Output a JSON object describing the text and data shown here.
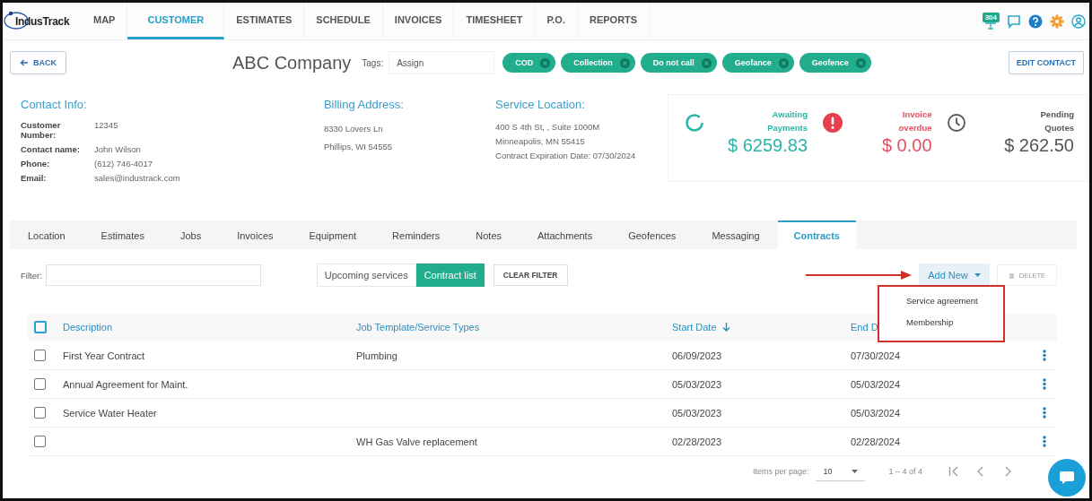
{
  "nav": {
    "logo": "IndusTrack",
    "items": [
      {
        "label": "MAP",
        "selected": false
      },
      {
        "label": "CUSTOMER",
        "selected": true
      },
      {
        "label": "ESTIMATES",
        "selected": false
      },
      {
        "label": "SCHEDULE",
        "selected": false
      },
      {
        "label": "INVOICES",
        "selected": false
      },
      {
        "label": "TIMESHEET",
        "selected": false
      },
      {
        "label": "P.O.",
        "selected": false
      },
      {
        "label": "REPORTS",
        "selected": false
      }
    ],
    "badge": "304"
  },
  "header": {
    "back": "BACK",
    "title": "ABC Company",
    "tags_label": "Tags:",
    "tag_input": {
      "placeholder": "Assign"
    },
    "tags": [
      "COD",
      "Collection",
      "Do not call",
      "Geofance",
      "Geofence"
    ],
    "edit": "EDIT CONTACT"
  },
  "contact": {
    "heading": "Contact Info:",
    "fields": [
      {
        "label": "Customer Number:",
        "value": "12345"
      },
      {
        "label": "Contact name:",
        "value": "John Wilson"
      },
      {
        "label": "Phone:",
        "value": "(612) 746-4017"
      },
      {
        "label": "Email:",
        "value": "sales@industrack.com"
      }
    ]
  },
  "billing": {
    "heading": "Billing Address:",
    "lines": [
      "8330 Lovers Ln",
      "Phillips, WI 54555"
    ]
  },
  "service": {
    "heading": "Service Location:",
    "lines": [
      "400 S 4th St, , Suite 1000M",
      "Minneapolis, MN 55415",
      "Contract Expiration Date: 07/30/2024"
    ]
  },
  "stats": [
    {
      "kind": "awaiting",
      "label": "Awaiting Payments",
      "amount": "$ 6259.83"
    },
    {
      "kind": "overdue",
      "label": "Invoice overdue",
      "amount": "$ 0.00"
    },
    {
      "kind": "pending",
      "label": "Pending Quotes",
      "amount": "$ 262.50"
    }
  ],
  "tabs": [
    {
      "label": "Location",
      "selected": false
    },
    {
      "label": "Estimates",
      "selected": false
    },
    {
      "label": "Jobs",
      "selected": false
    },
    {
      "label": "Invoices",
      "selected": false
    },
    {
      "label": "Equipment",
      "selected": false
    },
    {
      "label": "Reminders",
      "selected": false
    },
    {
      "label": "Notes",
      "selected": false
    },
    {
      "label": "Attachments",
      "selected": false
    },
    {
      "label": "Geofences",
      "selected": false
    },
    {
      "label": "Messaging",
      "selected": false
    },
    {
      "label": "Contracts",
      "selected": true
    }
  ],
  "toolbar": {
    "filter_label": "Filter:",
    "segments": [
      {
        "label": "Upcoming services",
        "selected": false
      },
      {
        "label": "Contract list",
        "selected": true
      }
    ],
    "clear": "CLEAR FILTER",
    "add_new": "Add New",
    "delete": {
      "label": "DELETE",
      "disabled": true
    }
  },
  "menu": {
    "items": [
      "Service agreement",
      "Membership"
    ]
  },
  "table": {
    "header_checked": false,
    "columns": [
      {
        "label": "Description",
        "sorted": false
      },
      {
        "label": "Job Template/Service Types",
        "sorted": false
      },
      {
        "label": "Start Date",
        "sorted": true
      },
      {
        "label": "End D",
        "sorted": false
      }
    ],
    "rows": [
      {
        "checked": false,
        "cells": [
          "First Year Contract",
          "Plumbing",
          "06/09/2023",
          "07/30/2024"
        ]
      },
      {
        "checked": false,
        "cells": [
          "Annual Agreement for Maint.",
          "",
          "05/03/2023",
          "05/03/2024"
        ]
      },
      {
        "checked": false,
        "cells": [
          "Service Water Heater",
          "",
          "05/03/2023",
          "05/03/2024"
        ]
      },
      {
        "checked": false,
        "cells": [
          "",
          "WH Gas Valve replacement",
          "02/28/2023",
          "02/28/2024"
        ]
      }
    ]
  },
  "pagination": {
    "label": "Items per page:",
    "per_page": "10",
    "range": "1 – 4 of 4"
  }
}
